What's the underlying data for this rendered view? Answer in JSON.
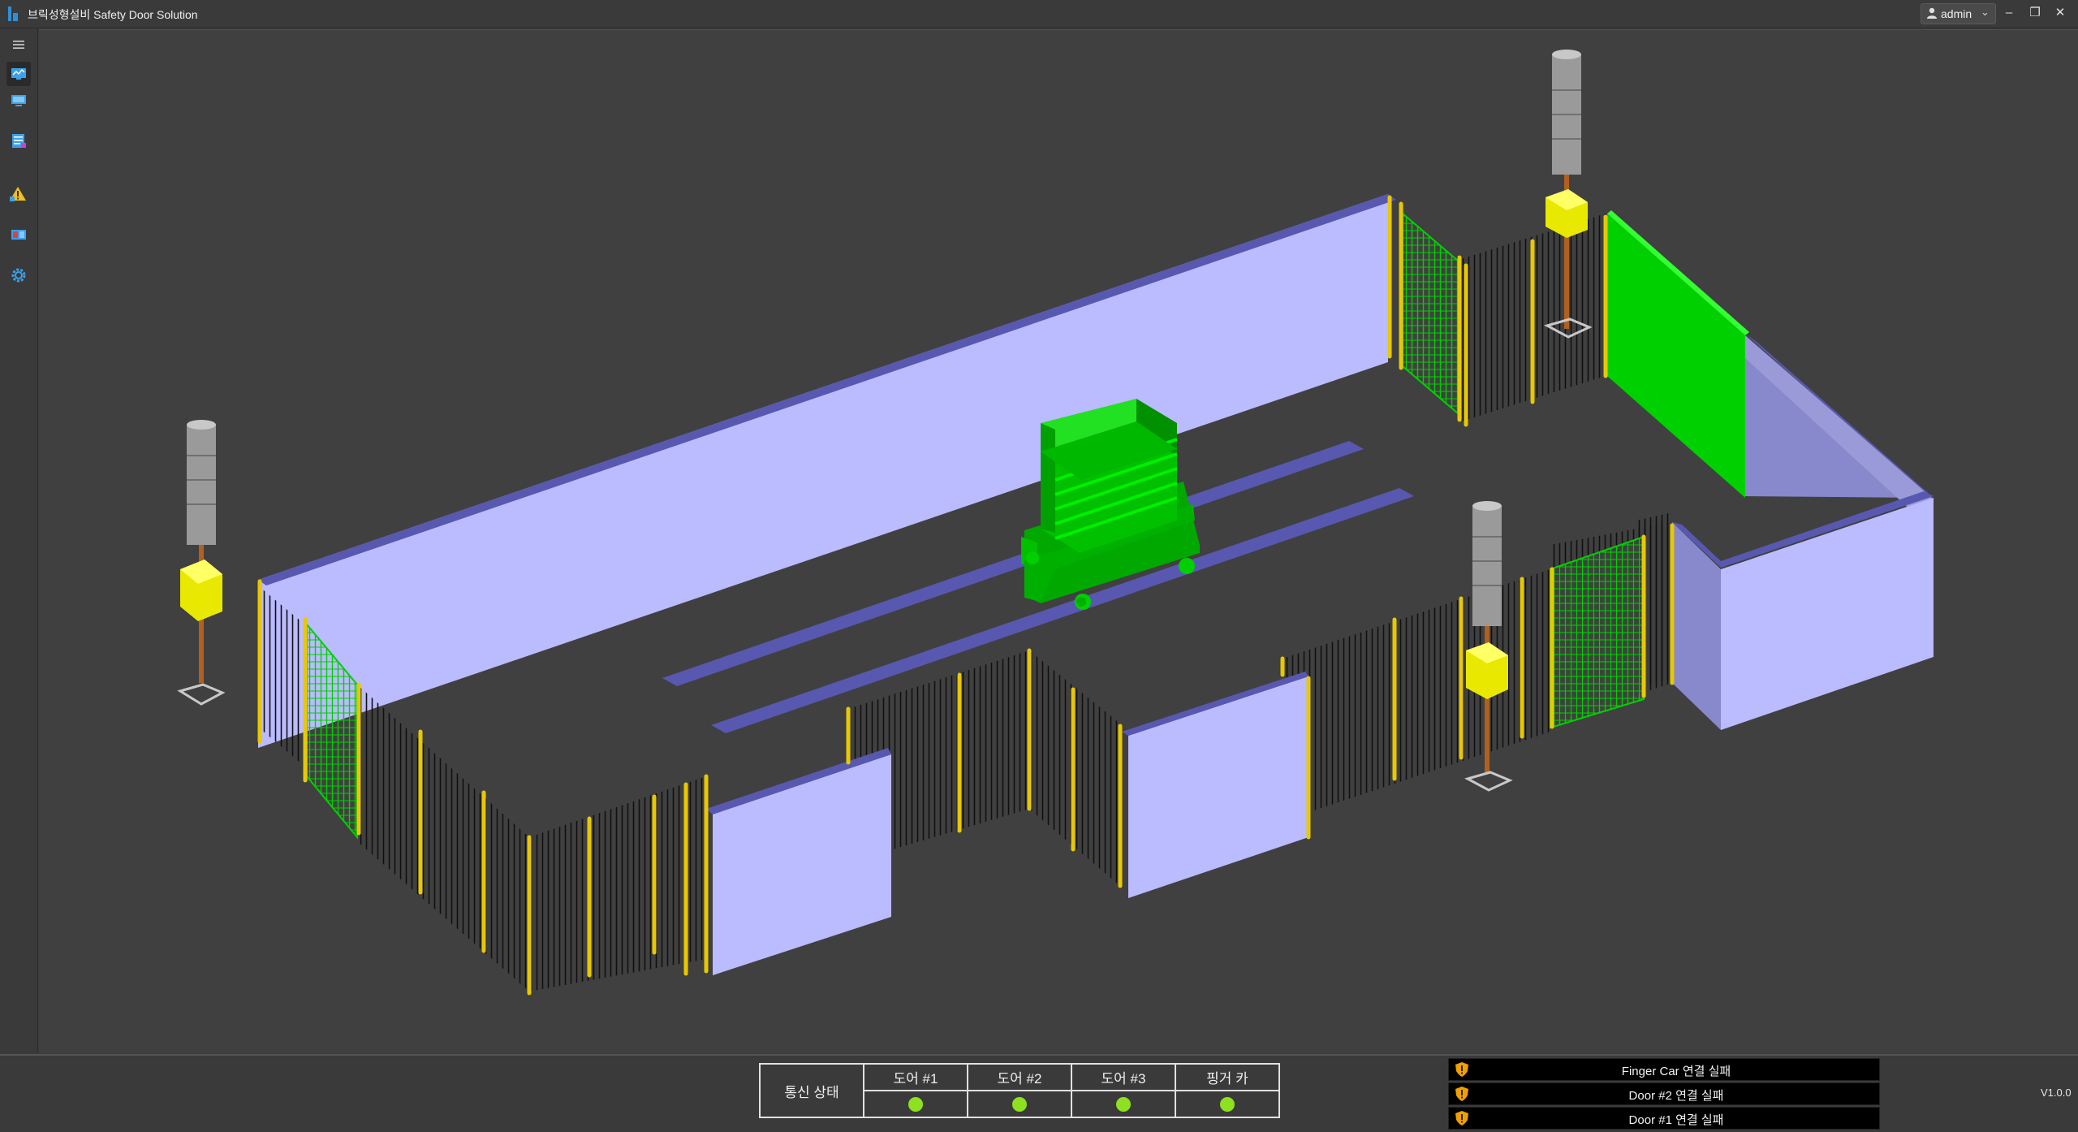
{
  "app": {
    "title": "브릭성형설비 Safety Door Solution",
    "user": "admin",
    "version": "V1.0.0"
  },
  "colors": {
    "accent": "#2f8fd8",
    "led_on": "#8fe020",
    "door_green": "#00d000",
    "fence_yellow": "#f0d000",
    "wall_light": "#bbbbff",
    "wall_dark": "#5858b0",
    "background": "#404040"
  },
  "sidebar": {
    "items": [
      {
        "name": "menu",
        "icon": "hamburger-icon"
      },
      {
        "name": "monitoring",
        "icon": "monitor-chart-icon"
      },
      {
        "name": "screen",
        "icon": "display-icon"
      },
      {
        "name": "report",
        "icon": "list-report-icon"
      },
      {
        "name": "alarm",
        "icon": "warning-triangle-icon"
      },
      {
        "name": "door",
        "icon": "door-panel-icon"
      },
      {
        "name": "settings",
        "icon": "gear-icon"
      }
    ]
  },
  "comm_status": {
    "label": "통신 상태",
    "devices": [
      {
        "name": "도어 #1",
        "status": "connected"
      },
      {
        "name": "도어 #2",
        "status": "connected"
      },
      {
        "name": "도어 #3",
        "status": "connected"
      },
      {
        "name": "핑거 카",
        "status": "connected"
      }
    ]
  },
  "alarms": [
    {
      "icon": "shield-warning-icon",
      "text": "Finger Car 연결 실패"
    },
    {
      "icon": "shield-warning-icon",
      "text": "Door #2 연결 실패"
    },
    {
      "icon": "shield-warning-icon",
      "text": "Door #1 연결 실패"
    }
  ]
}
